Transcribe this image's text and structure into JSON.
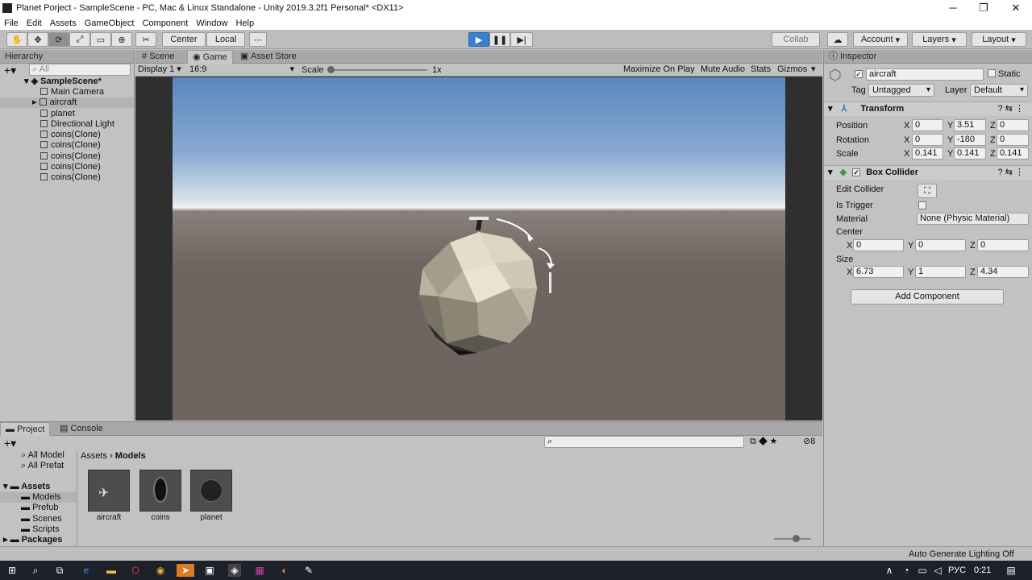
{
  "window": {
    "title": "Planet Porject - SampleScene - PC, Mac & Linux Standalone - Unity 2019.3.2f1 Personal* <DX11>",
    "min": "─",
    "max": "❐",
    "close": "✕"
  },
  "menu": [
    "File",
    "Edit",
    "Assets",
    "GameObject",
    "Component",
    "Window",
    "Help"
  ],
  "toolbar": {
    "center": "Center",
    "local": "Local",
    "collab": "Collab",
    "account": "Account",
    "layers": "Layers",
    "layout": "Layout"
  },
  "hierarchy": {
    "tab": "Hierarchy",
    "search_placeholder": "All",
    "scene": "SampleScene*",
    "items": [
      "Main Camera",
      "aircraft",
      "planet",
      "Directional Light",
      "coins(Clone)",
      "coins(Clone)",
      "coins(Clone)",
      "coins(Clone)",
      "coins(Clone)"
    ]
  },
  "scene_tabs": [
    "Scene",
    "Game",
    "Asset Store"
  ],
  "game_bar": {
    "display": "Display 1",
    "aspect": "16:9",
    "scale_label": "Scale",
    "scale_value": "1x",
    "maximize": "Maximize On Play",
    "mute": "Mute Audio",
    "stats": "Stats",
    "gizmos": "Gizmos"
  },
  "inspector": {
    "tab": "Inspector",
    "object_name": "aircraft",
    "static_label": "Static",
    "tag_label": "Tag",
    "tag_value": "Untagged",
    "layer_label": "Layer",
    "layer_value": "Default",
    "transform": {
      "title": "Transform",
      "position_label": "Position",
      "position": [
        "0",
        "3.51",
        "0"
      ],
      "rotation_label": "Rotation",
      "rotation": [
        "0",
        "-180",
        "0"
      ],
      "scale_label": "Scale",
      "scale": [
        "0.141",
        "0.141",
        "0.141"
      ]
    },
    "box_collider": {
      "title": "Box Collider",
      "edit_label": "Edit Collider",
      "trigger_label": "Is Trigger",
      "material_label": "Material",
      "material_value": "None (Physic Material)",
      "center_label": "Center",
      "center": [
        "0",
        "0",
        "0"
      ],
      "size_label": "Size",
      "size": [
        "6.73",
        "1",
        "4.34"
      ]
    },
    "add_component": "Add Component"
  },
  "project": {
    "tabs": [
      "Project",
      "Console"
    ],
    "favorites": [
      "All Model",
      "All Prefat"
    ],
    "tree_assets": "Assets",
    "folders": [
      "Models",
      "Prefub",
      "Scenes",
      "Scripts"
    ],
    "packages": "Packages",
    "breadcrumb": [
      "Assets",
      "Models"
    ],
    "assets": [
      "aircraft",
      "coins",
      "planet"
    ],
    "count": "8"
  },
  "status": {
    "text": "Auto Generate Lighting Off"
  },
  "taskbar": {
    "lang": "РУС",
    "time": "0:21"
  },
  "colors": {
    "play": "#3b7fd4",
    "sky_top": "#5b86c0",
    "ground": "#6f6560"
  }
}
